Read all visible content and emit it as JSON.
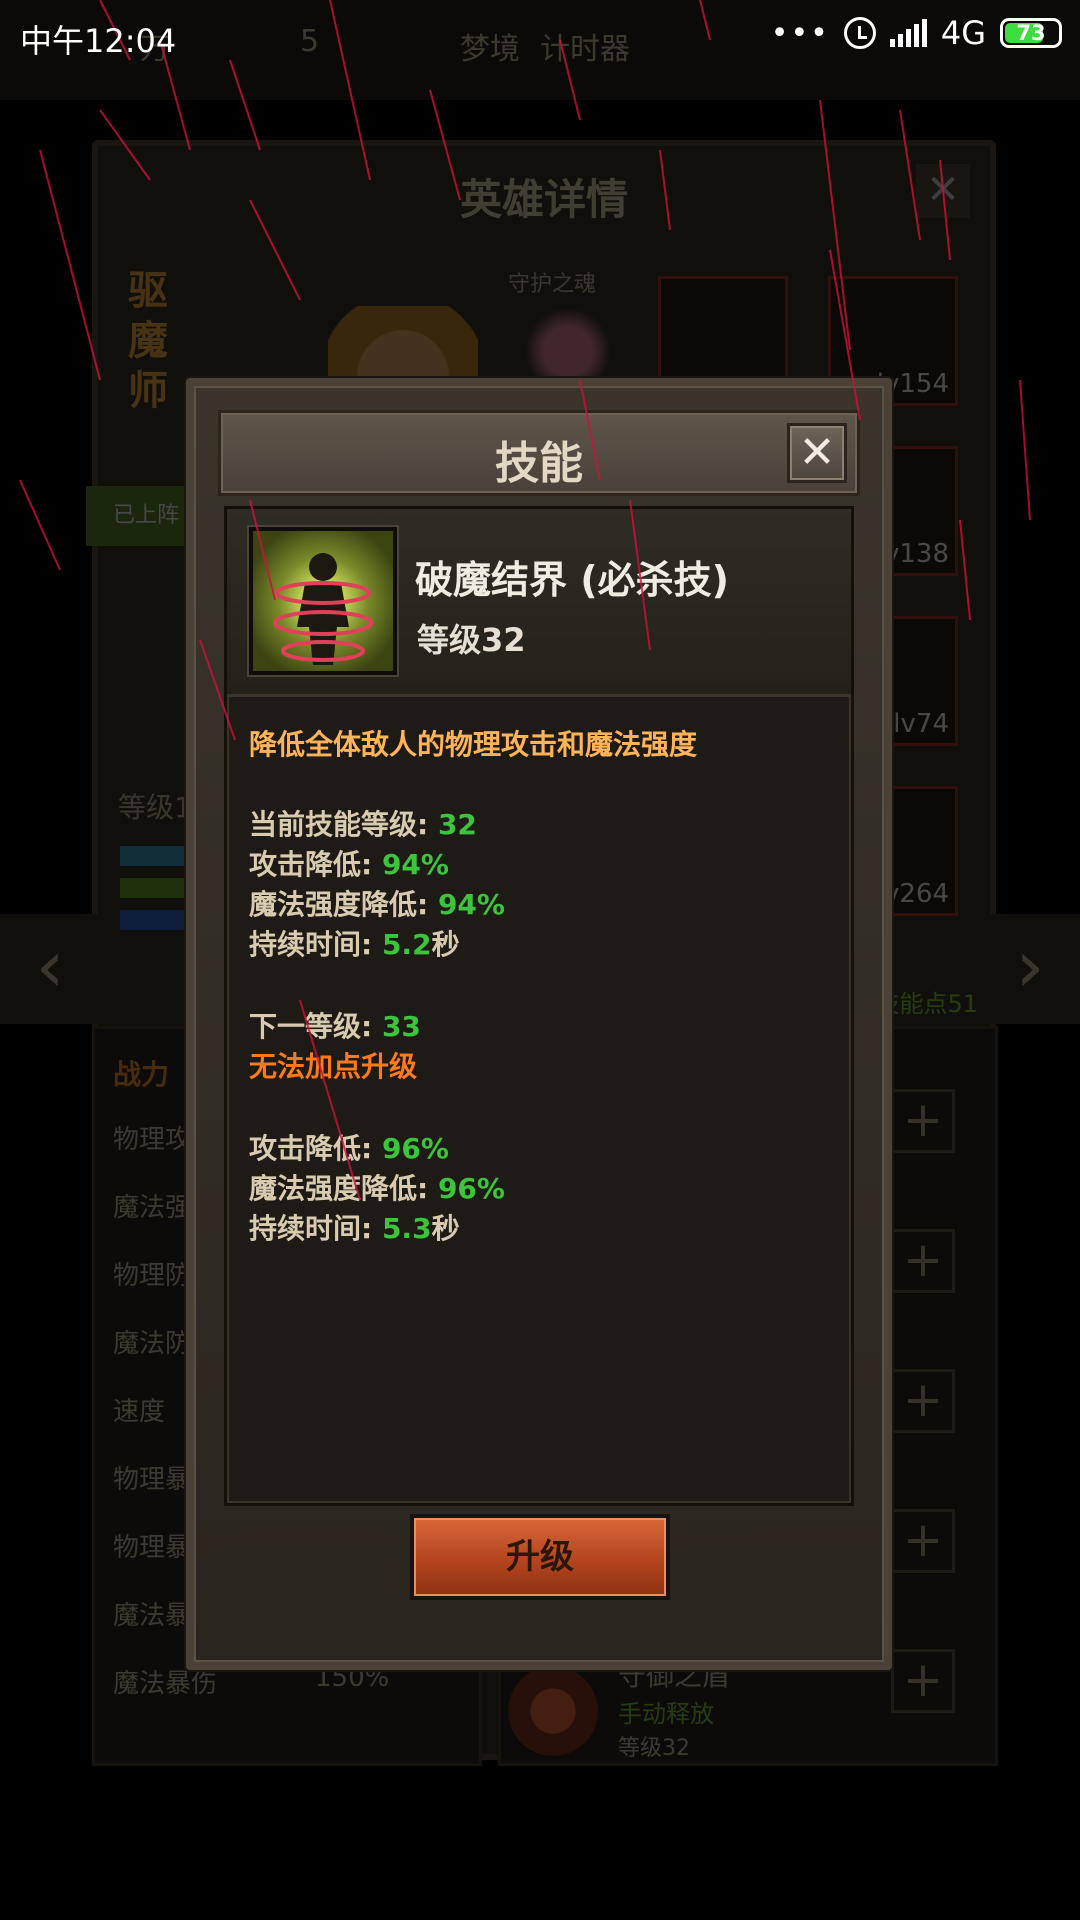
{
  "status_bar": {
    "time": "中午12:04",
    "network": "4G",
    "battery": "73"
  },
  "background": {
    "nav_tabs": [
      "万",
      "5",
      "梦境",
      "计时器"
    ],
    "panel_title": "英雄详情",
    "hero_class": "驱魔师",
    "guardian_label": "守护之魂",
    "deployed_tag": "已上阵",
    "level_label": "等级1",
    "equipment": [
      "",
      "lv154",
      "lv138",
      "lv74",
      "lv264"
    ],
    "skill_points": "技能点51",
    "stats": {
      "power_label": "战力",
      "rows": [
        {
          "label": "物理攻",
          "value": ""
        },
        {
          "label": "魔法强",
          "value": ""
        },
        {
          "label": "物理防",
          "value": ""
        },
        {
          "label": "魔法防",
          "value": ""
        },
        {
          "label": "速度",
          "value": ""
        },
        {
          "label": "物理暴",
          "value": ""
        },
        {
          "label": "物理暴",
          "value": ""
        },
        {
          "label": "魔法暴",
          "value": ""
        },
        {
          "label": "魔法暴伤",
          "value": "150%"
        }
      ]
    },
    "bottom_skill": {
      "name": "守御之盾",
      "mode": "手动释放",
      "level": "等级32"
    }
  },
  "dialog": {
    "title": "技能",
    "close_glyph": "✕",
    "skill_name": "破魔结界 (必杀技)",
    "skill_level": "等级32",
    "description": "降低全体敌人的物理攻击和魔法强度",
    "current": {
      "level_label": "当前技能等级: ",
      "level_value": "32",
      "attack_label": "攻击降低: ",
      "attack_value": "94%",
      "magic_label": "魔法强度降低: ",
      "magic_value": "94%",
      "duration_label": "持续时间: ",
      "duration_value": "5.2",
      "duration_unit": "秒"
    },
    "next": {
      "level_label": "下一等级: ",
      "level_value": "33",
      "warning": "无法加点升级",
      "attack_label": "攻击降低: ",
      "attack_value": "96%",
      "magic_label": "魔法强度降低: ",
      "magic_value": "96%",
      "duration_label": "持续时间: ",
      "duration_value": "5.3",
      "duration_unit": "秒"
    },
    "upgrade_button": "升级"
  },
  "colors": {
    "value_green": "#3cc53c",
    "description_orange": "#ffb45a",
    "warning_orange": "#ff7a1a",
    "button_orange": "#b4441d"
  }
}
